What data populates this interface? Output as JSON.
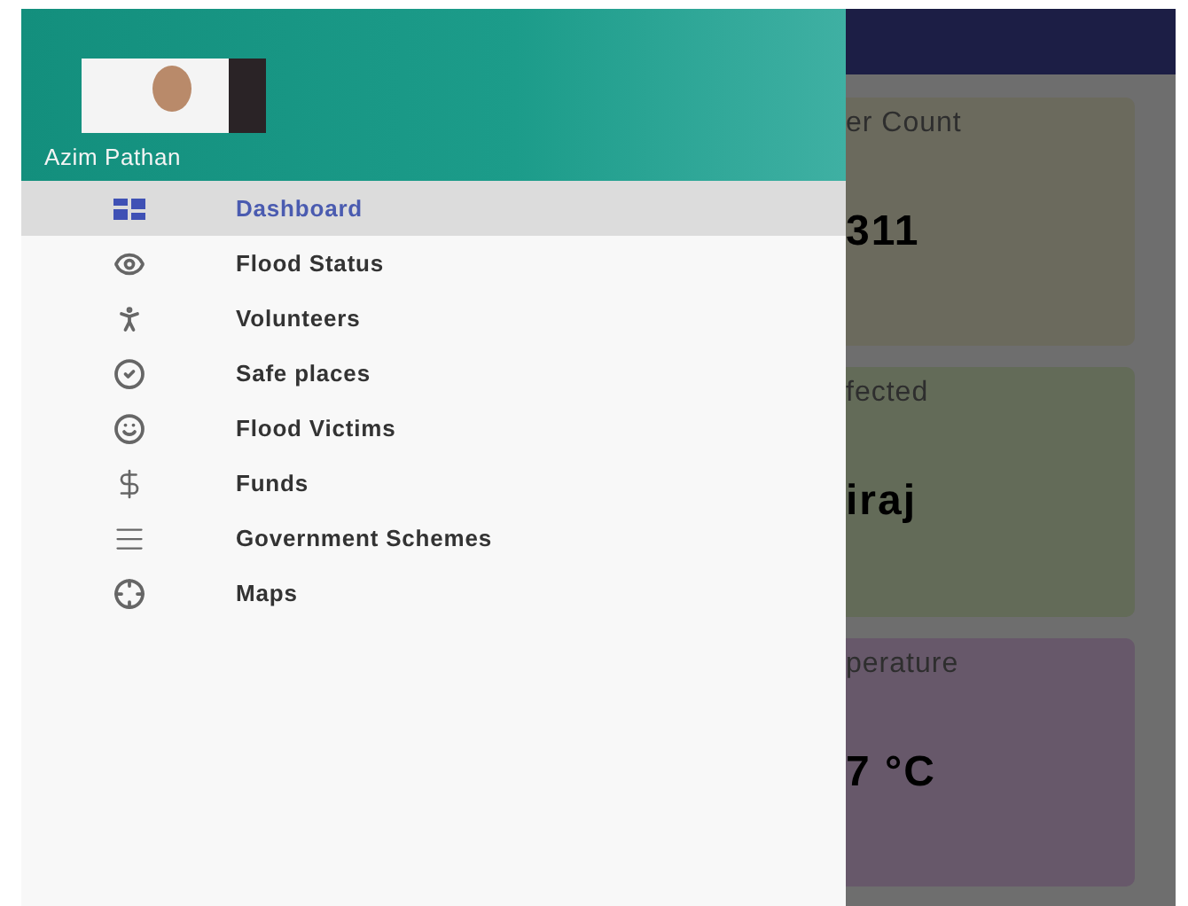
{
  "drawer": {
    "user_name": "Azim Pathan",
    "items": [
      {
        "label": "Dashboard",
        "kind": "dashboard",
        "selected": true
      },
      {
        "label": "Flood Status",
        "kind": "eye",
        "selected": false
      },
      {
        "label": "Volunteers",
        "kind": "person",
        "selected": false
      },
      {
        "label": "Safe places",
        "kind": "check",
        "selected": false
      },
      {
        "label": "Flood Victims",
        "kind": "face",
        "selected": false
      },
      {
        "label": "Funds",
        "kind": "dollar",
        "selected": false
      },
      {
        "label": "Government Schemes",
        "kind": "lines",
        "selected": false
      },
      {
        "label": "Maps",
        "kind": "location",
        "selected": false
      }
    ]
  },
  "cards": [
    {
      "title": "er Count",
      "value": "311",
      "color": "#6b6a5d"
    },
    {
      "title": "fected",
      "value": "iraj",
      "color": "#636b58"
    },
    {
      "title": "perature",
      "value": "7 °C",
      "color": "#67586a"
    }
  ]
}
